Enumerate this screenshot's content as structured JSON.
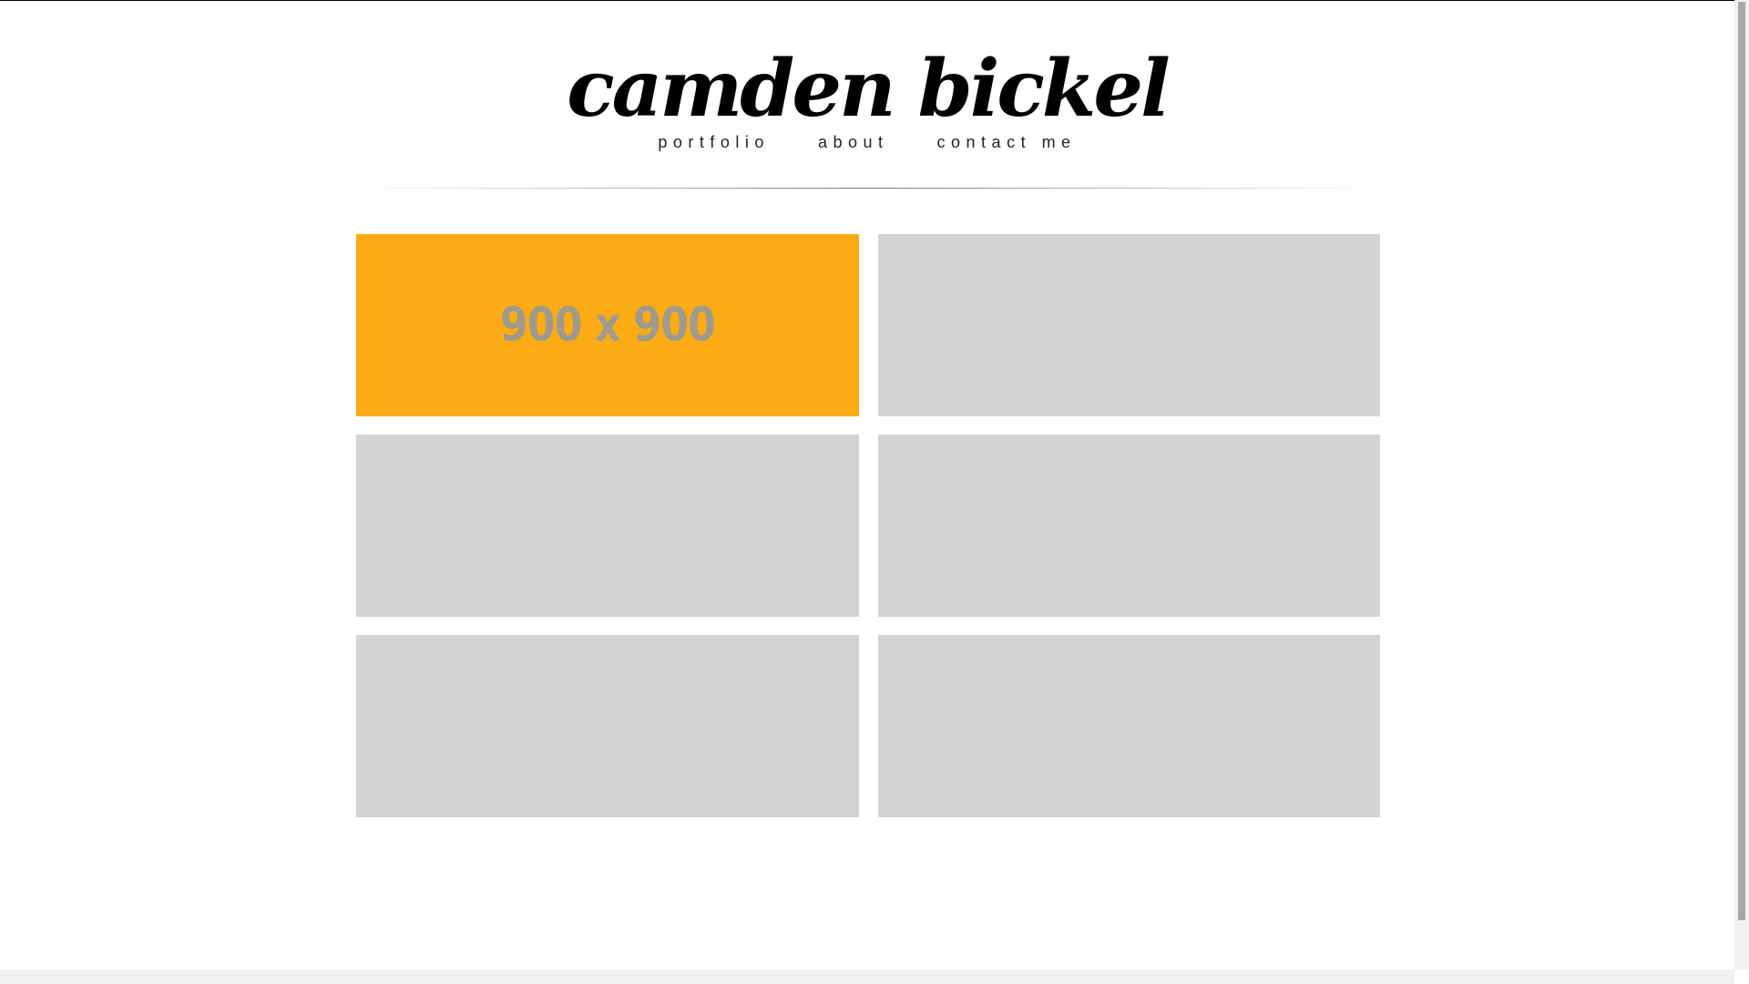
{
  "header": {
    "title": "camden bickel"
  },
  "nav": {
    "items": [
      {
        "label": "portfolio"
      },
      {
        "label": "about"
      },
      {
        "label": "contact me"
      }
    ]
  },
  "portfolio": {
    "tiles": [
      {
        "label": "900 x 900",
        "highlighted": true
      },
      {
        "label": "",
        "highlighted": false
      },
      {
        "label": "",
        "highlighted": false
      },
      {
        "label": "",
        "highlighted": false
      },
      {
        "label": "",
        "highlighted": false
      },
      {
        "label": "",
        "highlighted": false
      }
    ]
  },
  "colors": {
    "highlight": "#fbab15",
    "tile": "#d3d3d3",
    "tile_label": "#a09a8c",
    "text": "#000000"
  }
}
